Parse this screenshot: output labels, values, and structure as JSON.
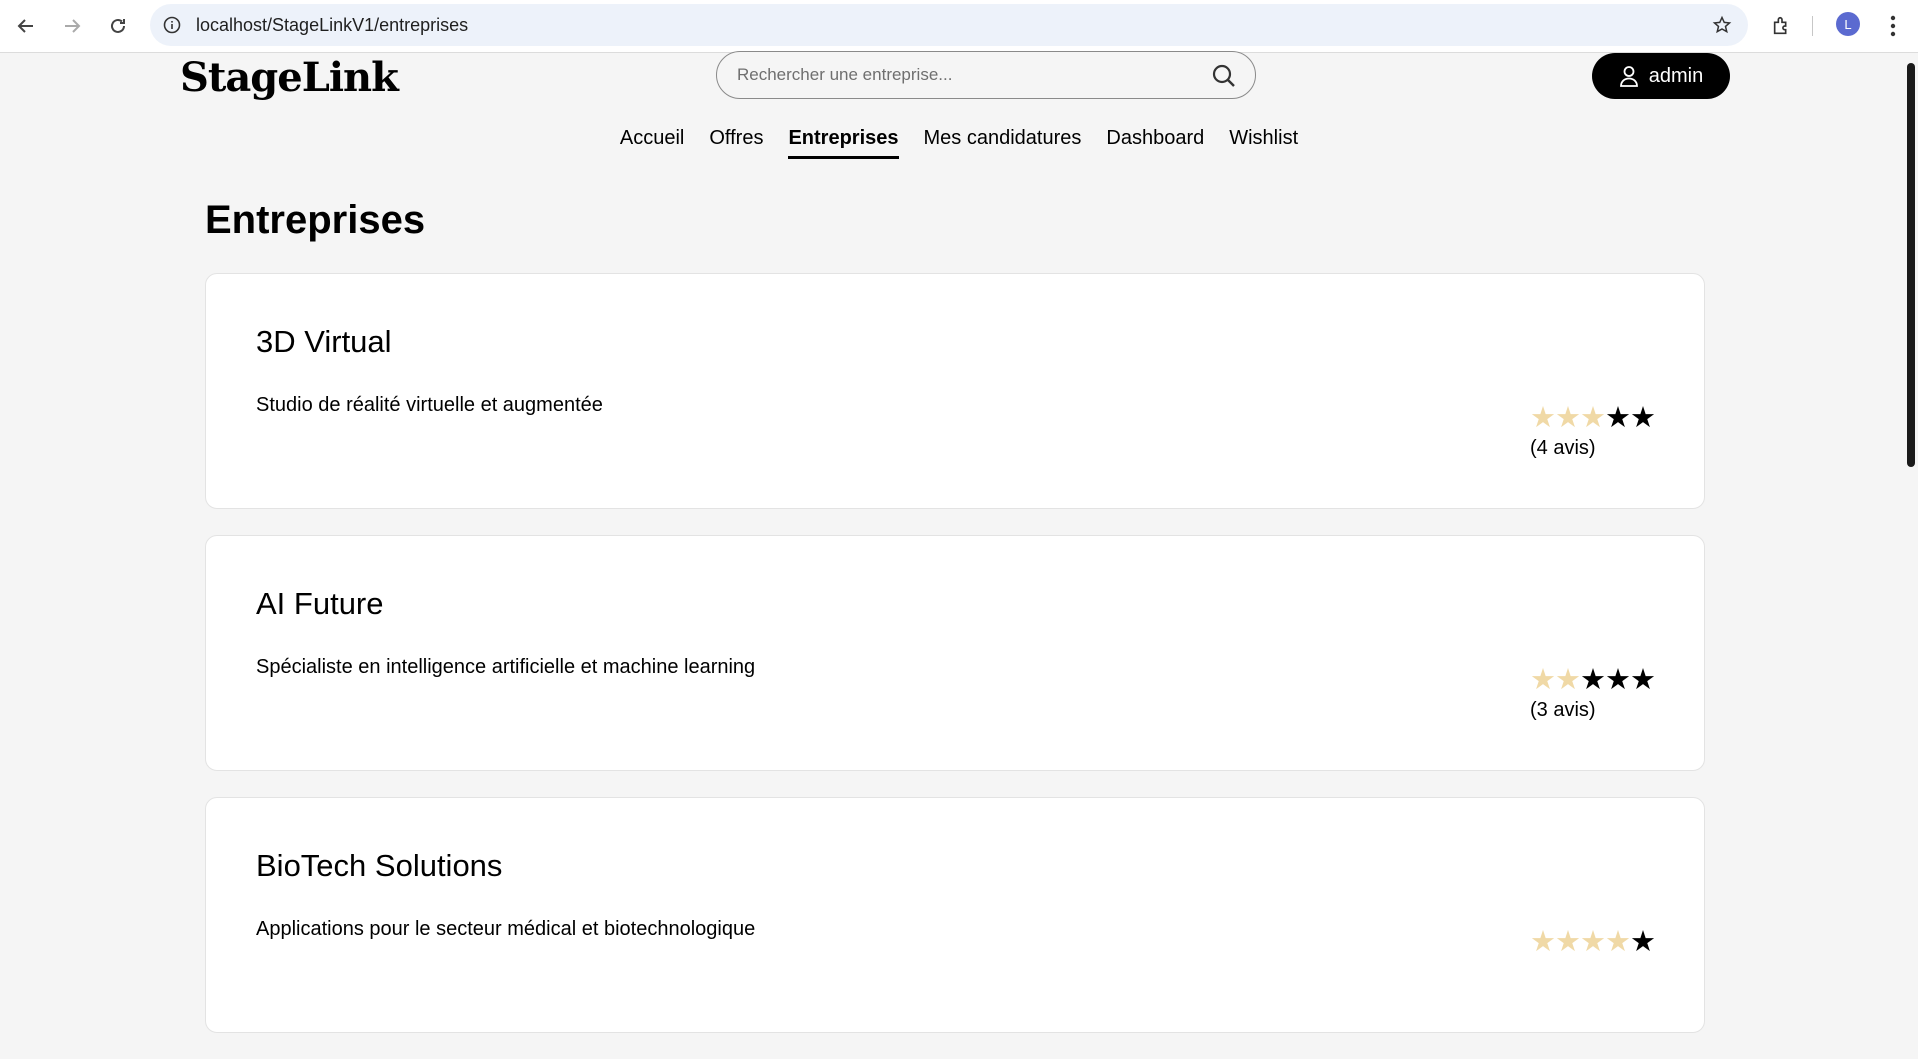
{
  "browser": {
    "url": "localhost/StageLinkV1/entreprises",
    "profile_initial": "L"
  },
  "header": {
    "logo": "StageLink",
    "search_placeholder": "Rechercher une entreprise...",
    "user_label": "admin"
  },
  "nav": {
    "items": [
      {
        "label": "Accueil"
      },
      {
        "label": "Offres"
      },
      {
        "label": "Entreprises"
      },
      {
        "label": "Mes candidatures"
      },
      {
        "label": "Dashboard"
      },
      {
        "label": "Wishlist"
      }
    ],
    "active": "Entreprises"
  },
  "page": {
    "title": "Entreprises"
  },
  "companies": [
    {
      "name": "3D Virtual",
      "description": "Studio de réalité virtuelle et augmentée",
      "rating": 3,
      "max_rating": 5,
      "reviews": "(4 avis)"
    },
    {
      "name": "AI Future",
      "description": "Spécialiste en intelligence artificielle et machine learning",
      "rating": 2,
      "max_rating": 5,
      "reviews": "(3 avis)"
    },
    {
      "name": "BioTech Solutions",
      "description": "Applications pour le secteur médical et biotechnologique",
      "rating": 4,
      "max_rating": 5,
      "reviews": ""
    }
  ],
  "colors": {
    "star_filled": "#f0d9a6",
    "star_empty": "#000000",
    "accent": "#000000"
  }
}
